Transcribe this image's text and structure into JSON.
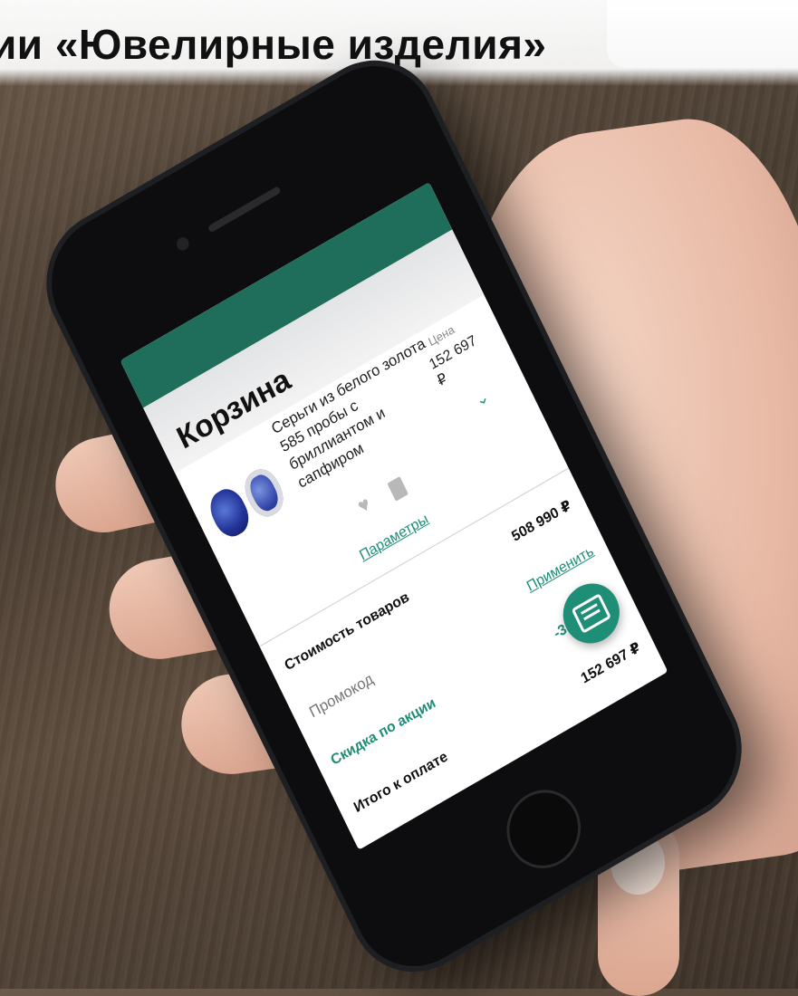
{
  "headline": "ии «Ювелирные изделия»",
  "app": {
    "title": "Корзина",
    "product": {
      "name": "Серьги из белого золота 585 пробы с бриллиантом и сапфиром",
      "price_label": "Цена",
      "price_value": "152 697 ₽",
      "params_link": "Параметры"
    },
    "summary": {
      "goods_cost_label": "Стоимость товаров",
      "goods_cost_value": "508 990 ₽",
      "promo_placeholder": "Промокод",
      "apply_link": "Применить",
      "discount_label": "Скидка по акции",
      "discount_value": "-356 293 ₽",
      "total_label": "Итого к оплате",
      "total_value": "152 697 ₽"
    },
    "icons": {
      "chevron": "chevron-down-icon",
      "heart": "heart-icon",
      "trash": "trash-icon",
      "chat": "chat-icon"
    },
    "colors": {
      "accent": "#1f8e77",
      "status_bar": "#1f6d5b"
    }
  }
}
